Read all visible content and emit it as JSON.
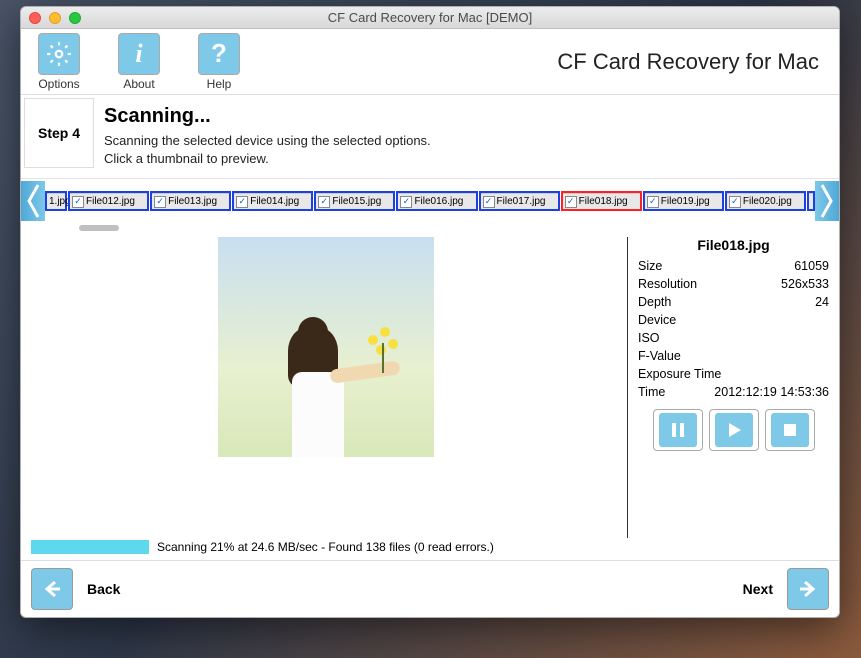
{
  "window": {
    "title": "CF Card Recovery for Mac [DEMO]"
  },
  "toolbar": {
    "options": "Options",
    "about": "About",
    "help": "Help",
    "app_title": "CF Card Recovery for Mac"
  },
  "step": {
    "label": "Step 4",
    "heading": "Scanning...",
    "line1": "Scanning the selected device using the selected options.",
    "line2": "Click a thumbnail to preview."
  },
  "thumbs": {
    "partial_left": "1.jpg",
    "items": [
      {
        "label": "File012.jpg"
      },
      {
        "label": "File013.jpg"
      },
      {
        "label": "File014.jpg"
      },
      {
        "label": "File015.jpg"
      },
      {
        "label": "File016.jpg"
      },
      {
        "label": "File017.jpg"
      },
      {
        "label": "File018.jpg",
        "selected": true
      },
      {
        "label": "File019.jpg"
      },
      {
        "label": "File020.jpg"
      }
    ]
  },
  "detail": {
    "filename": "File018.jpg",
    "rows": [
      {
        "k": "Size",
        "v": "61059"
      },
      {
        "k": "Resolution",
        "v": "526x533"
      },
      {
        "k": "Depth",
        "v": "24"
      },
      {
        "k": "Device",
        "v": ""
      },
      {
        "k": "ISO",
        "v": ""
      },
      {
        "k": "F-Value",
        "v": ""
      },
      {
        "k": "Exposure Time",
        "v": ""
      },
      {
        "k": "Time",
        "v": "2012:12:19 14:53:36"
      }
    ]
  },
  "progress": {
    "percent": 21,
    "text": "Scanning 21% at 24.6 MB/sec - Found 138 files (0 read errors.)"
  },
  "nav": {
    "back": "Back",
    "next": "Next"
  }
}
